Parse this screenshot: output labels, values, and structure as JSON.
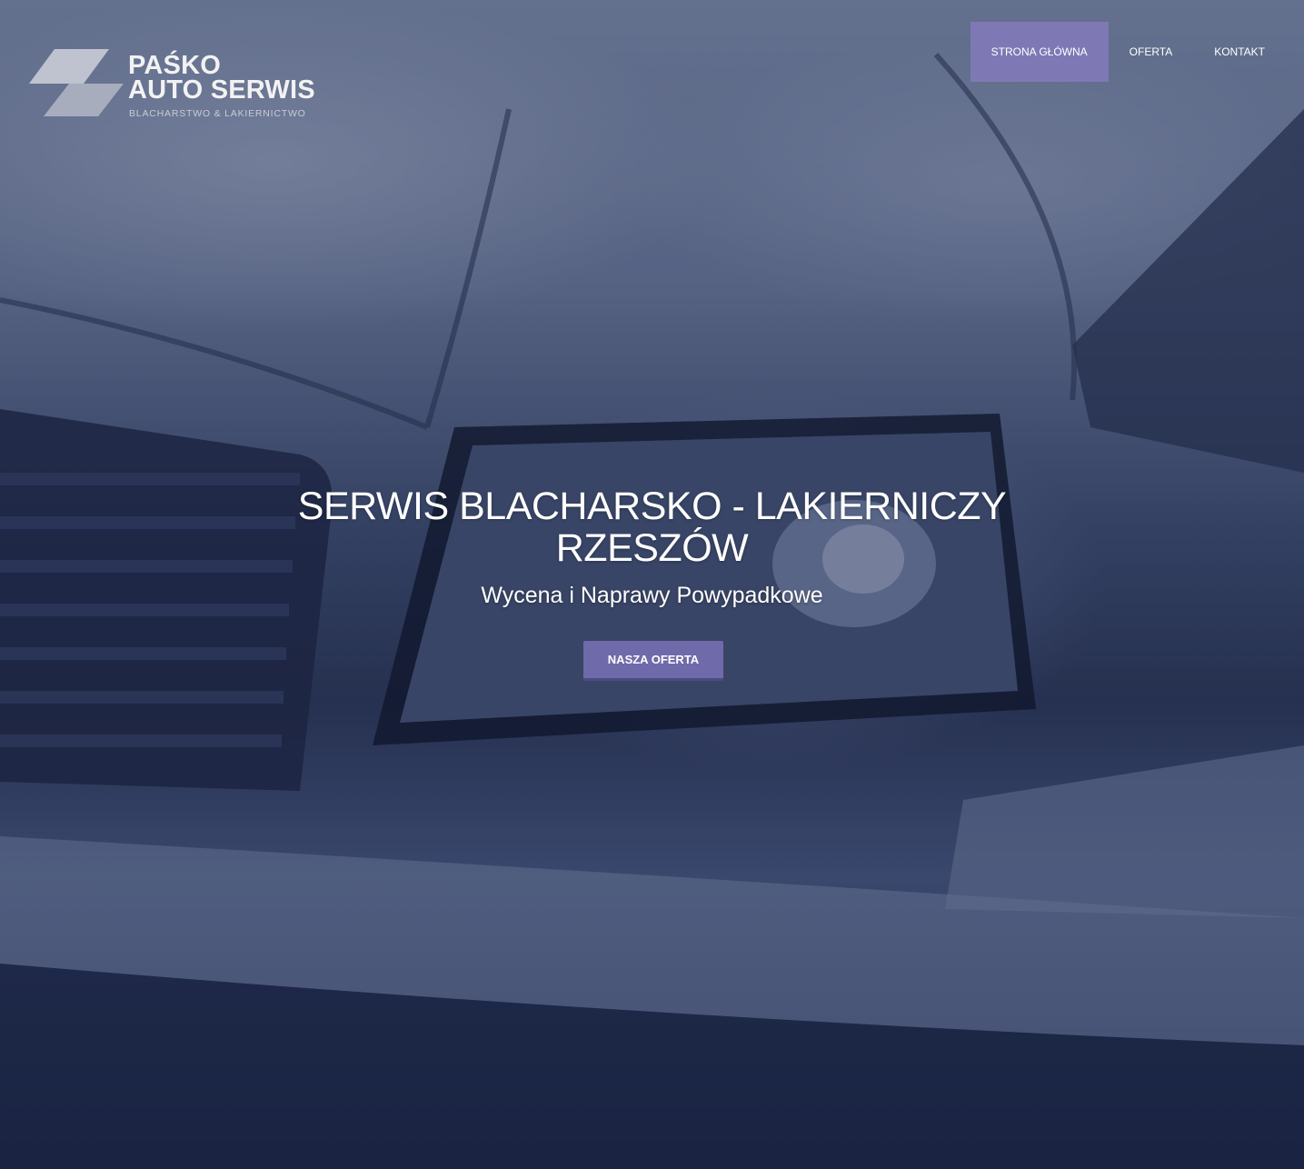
{
  "colors": {
    "accent": "#7e79b5",
    "button": "#6f6aa9",
    "text": "#ffffff"
  },
  "logo": {
    "line1": "PAŚKO",
    "line2": "AUTO SERWIS",
    "tagline": "BLACHARSTWO & LAKIERNICTWO"
  },
  "nav": {
    "items": [
      {
        "label": "STRONA GŁÓWNA",
        "active": true
      },
      {
        "label": "OFERTA",
        "active": false
      },
      {
        "label": "KONTAKT",
        "active": false
      }
    ]
  },
  "hero": {
    "title_line1": "SERWIS BLACHARSKO - LAKIERNICZY",
    "title_line2": "RZESZÓW",
    "subtitle": "Wycena i Naprawy Powypadkowe",
    "button_label": "NASZA OFERTA"
  }
}
